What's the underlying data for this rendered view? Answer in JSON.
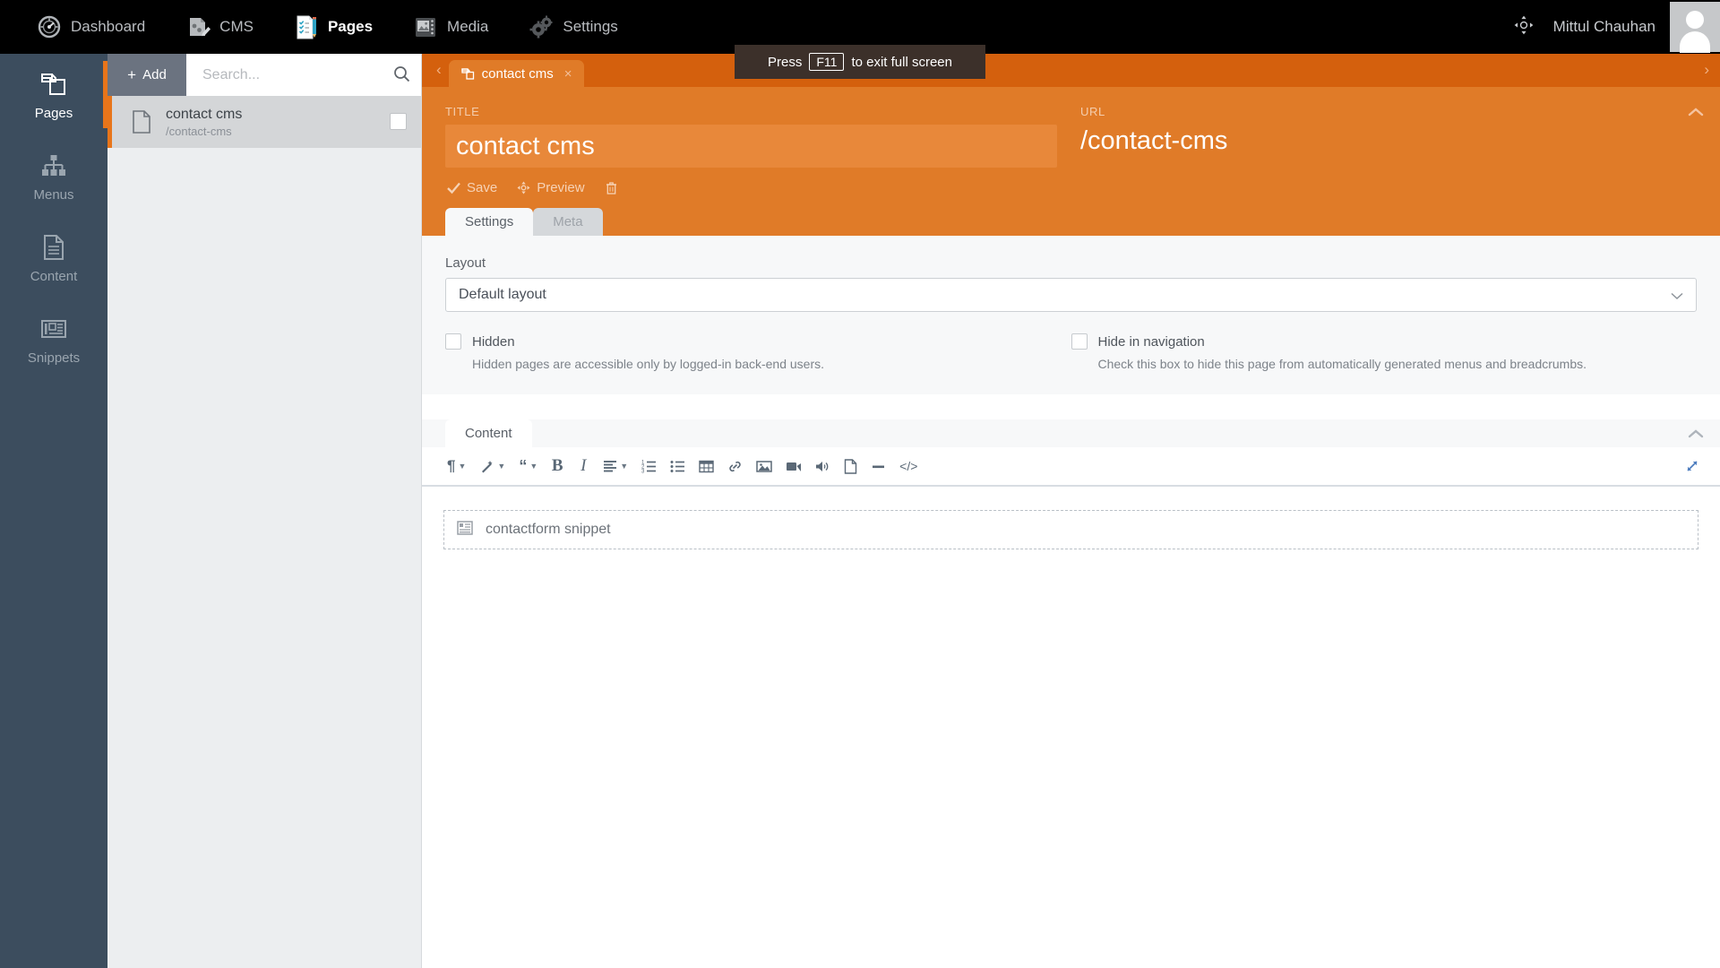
{
  "topnav": {
    "items": [
      {
        "label": "Dashboard",
        "icon": "dashboard-icon",
        "active": false
      },
      {
        "label": "CMS",
        "icon": "cms-icon",
        "active": false
      },
      {
        "label": "Pages",
        "icon": "pages-icon",
        "active": true
      },
      {
        "label": "Media",
        "icon": "media-icon",
        "active": false
      },
      {
        "label": "Settings",
        "icon": "settings-gear-icon",
        "active": false
      }
    ],
    "user_name": "Mittul Chauhan",
    "move_icon": "move-arrows-icon",
    "avatar_icon": "user-avatar-icon"
  },
  "sidebar": {
    "items": [
      {
        "label": "Pages",
        "icon": "pages-stack-icon",
        "active": true
      },
      {
        "label": "Menus",
        "icon": "sitemap-icon",
        "active": false
      },
      {
        "label": "Content",
        "icon": "document-lines-icon",
        "active": false
      },
      {
        "label": "Snippets",
        "icon": "snippet-layout-icon",
        "active": false
      }
    ]
  },
  "listpanel": {
    "add_label": "Add",
    "add_plus": "+",
    "search_placeholder": "Search...",
    "search_value": "",
    "rows": [
      {
        "title": "contact cms",
        "url": "/contact-cms",
        "selected": true
      }
    ]
  },
  "tabstrip": {
    "left_chevron": "‹",
    "right_chevron": "›",
    "tabs": [
      {
        "label": "contact cms",
        "close": "×",
        "active": true
      }
    ]
  },
  "tooltip": {
    "prefix": "Press",
    "key": "F11",
    "suffix": "to exit full screen"
  },
  "header": {
    "title_label": "TITLE",
    "title_value": "contact cms",
    "url_label": "URL",
    "url_value": "/contact-cms",
    "collapse_icon": "⌃",
    "actions": [
      {
        "label": "Save",
        "icon": "check-icon"
      },
      {
        "label": "Preview",
        "icon": "preview-arrows-icon"
      },
      {
        "label": "",
        "icon": "trash-icon"
      }
    ]
  },
  "form_tabs": [
    {
      "label": "Settings",
      "active": true
    },
    {
      "label": "Meta",
      "active": false
    }
  ],
  "settings": {
    "layout_label": "Layout",
    "layout_value": "Default layout",
    "layout_caret": "⌄",
    "hidden": {
      "label": "Hidden",
      "help": "Hidden pages are accessible only by logged-in back-end users.",
      "checked": false
    },
    "hide_in_nav": {
      "label": "Hide in navigation",
      "help": "Check this box to hide this page from automatically generated menus and breadcrumbs.",
      "checked": false
    }
  },
  "content_section": {
    "tab_label": "Content",
    "collapse_icon": "⌃",
    "toolbar": [
      {
        "name": "paragraph-format-icon",
        "glyph": "¶",
        "caret": true
      },
      {
        "name": "magic-wand-icon",
        "glyph": "",
        "caret": true
      },
      {
        "name": "quote-icon",
        "glyph": "“",
        "caret": true
      },
      {
        "name": "bold-icon",
        "glyph": "B",
        "caret": false
      },
      {
        "name": "italic-icon",
        "glyph": "I",
        "caret": false
      },
      {
        "name": "align-icon",
        "glyph": "",
        "caret": true
      },
      {
        "name": "ordered-list-icon",
        "glyph": "",
        "caret": false
      },
      {
        "name": "unordered-list-icon",
        "glyph": "",
        "caret": false
      },
      {
        "name": "table-icon",
        "glyph": "",
        "caret": false
      },
      {
        "name": "link-icon",
        "glyph": "",
        "caret": false
      },
      {
        "name": "image-icon",
        "glyph": "",
        "caret": false
      },
      {
        "name": "video-icon",
        "glyph": "",
        "caret": false
      },
      {
        "name": "audio-icon",
        "glyph": "",
        "caret": false
      },
      {
        "name": "file-icon",
        "glyph": "",
        "caret": false
      },
      {
        "name": "horizontal-rule-icon",
        "glyph": "",
        "caret": false
      },
      {
        "name": "code-icon",
        "glyph": "</>",
        "caret": false
      }
    ],
    "expand_icon": "fullscreen-expand-icon",
    "snippet": {
      "label": "contactform snippet",
      "icon": "snippet-block-icon"
    }
  },
  "colors": {
    "accent_orange": "#e07b28",
    "tabstrip_orange": "#d4600d",
    "sidebar_blue": "#3c4d5e",
    "topnav_black": "#000000",
    "panel_gray": "#eceef0",
    "tooltip_brown": "#3c302a"
  }
}
